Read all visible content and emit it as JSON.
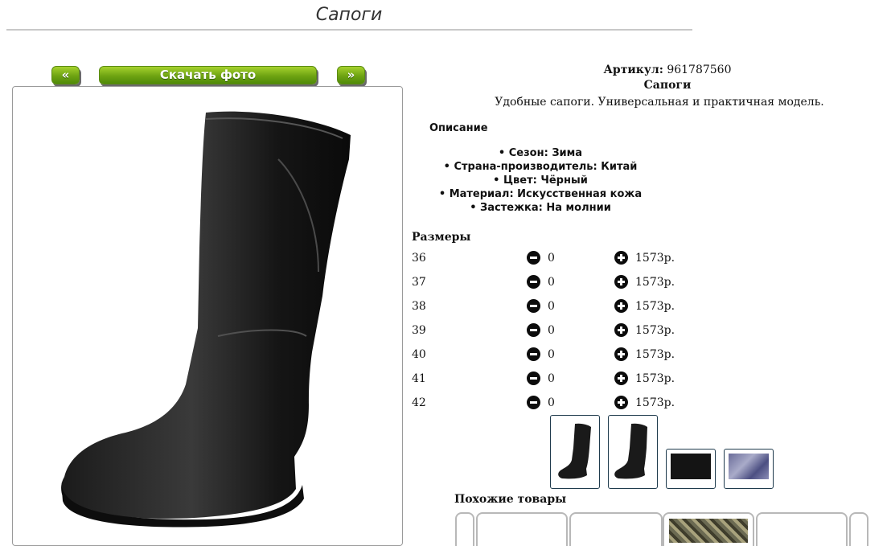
{
  "header": {
    "title": "Сапоги"
  },
  "gallery_nav": {
    "prev_label": "«",
    "download_label": "Скачать фото",
    "next_label": "»"
  },
  "product": {
    "article_label": "Артикул:",
    "article_value": "961787560",
    "name": "Сапоги",
    "short_description": "Удобные сапоги. Универсальная и практичная модель."
  },
  "description": {
    "heading": "Описание",
    "attributes": [
      "Сезон: Зима",
      "Страна-производитель: Китай",
      "Цвет: Чёрный",
      "Материал: Искусственная кожа",
      "Застежка: На молнии"
    ]
  },
  "sizes": {
    "heading": "Размеры",
    "rows": [
      {
        "size": "36",
        "qty": "0",
        "price": "1573р."
      },
      {
        "size": "37",
        "qty": "0",
        "price": "1573р."
      },
      {
        "size": "38",
        "qty": "0",
        "price": "1573р."
      },
      {
        "size": "39",
        "qty": "0",
        "price": "1573р."
      },
      {
        "size": "40",
        "qty": "0",
        "price": "1573р."
      },
      {
        "size": "41",
        "qty": "0",
        "price": "1573р."
      },
      {
        "size": "42",
        "qty": "0",
        "price": "1573р."
      }
    ]
  },
  "similar": {
    "heading": "Похожие товары"
  },
  "colors": {
    "accent_green": "#6ea312",
    "thumb_border": "#1f3b4d"
  }
}
